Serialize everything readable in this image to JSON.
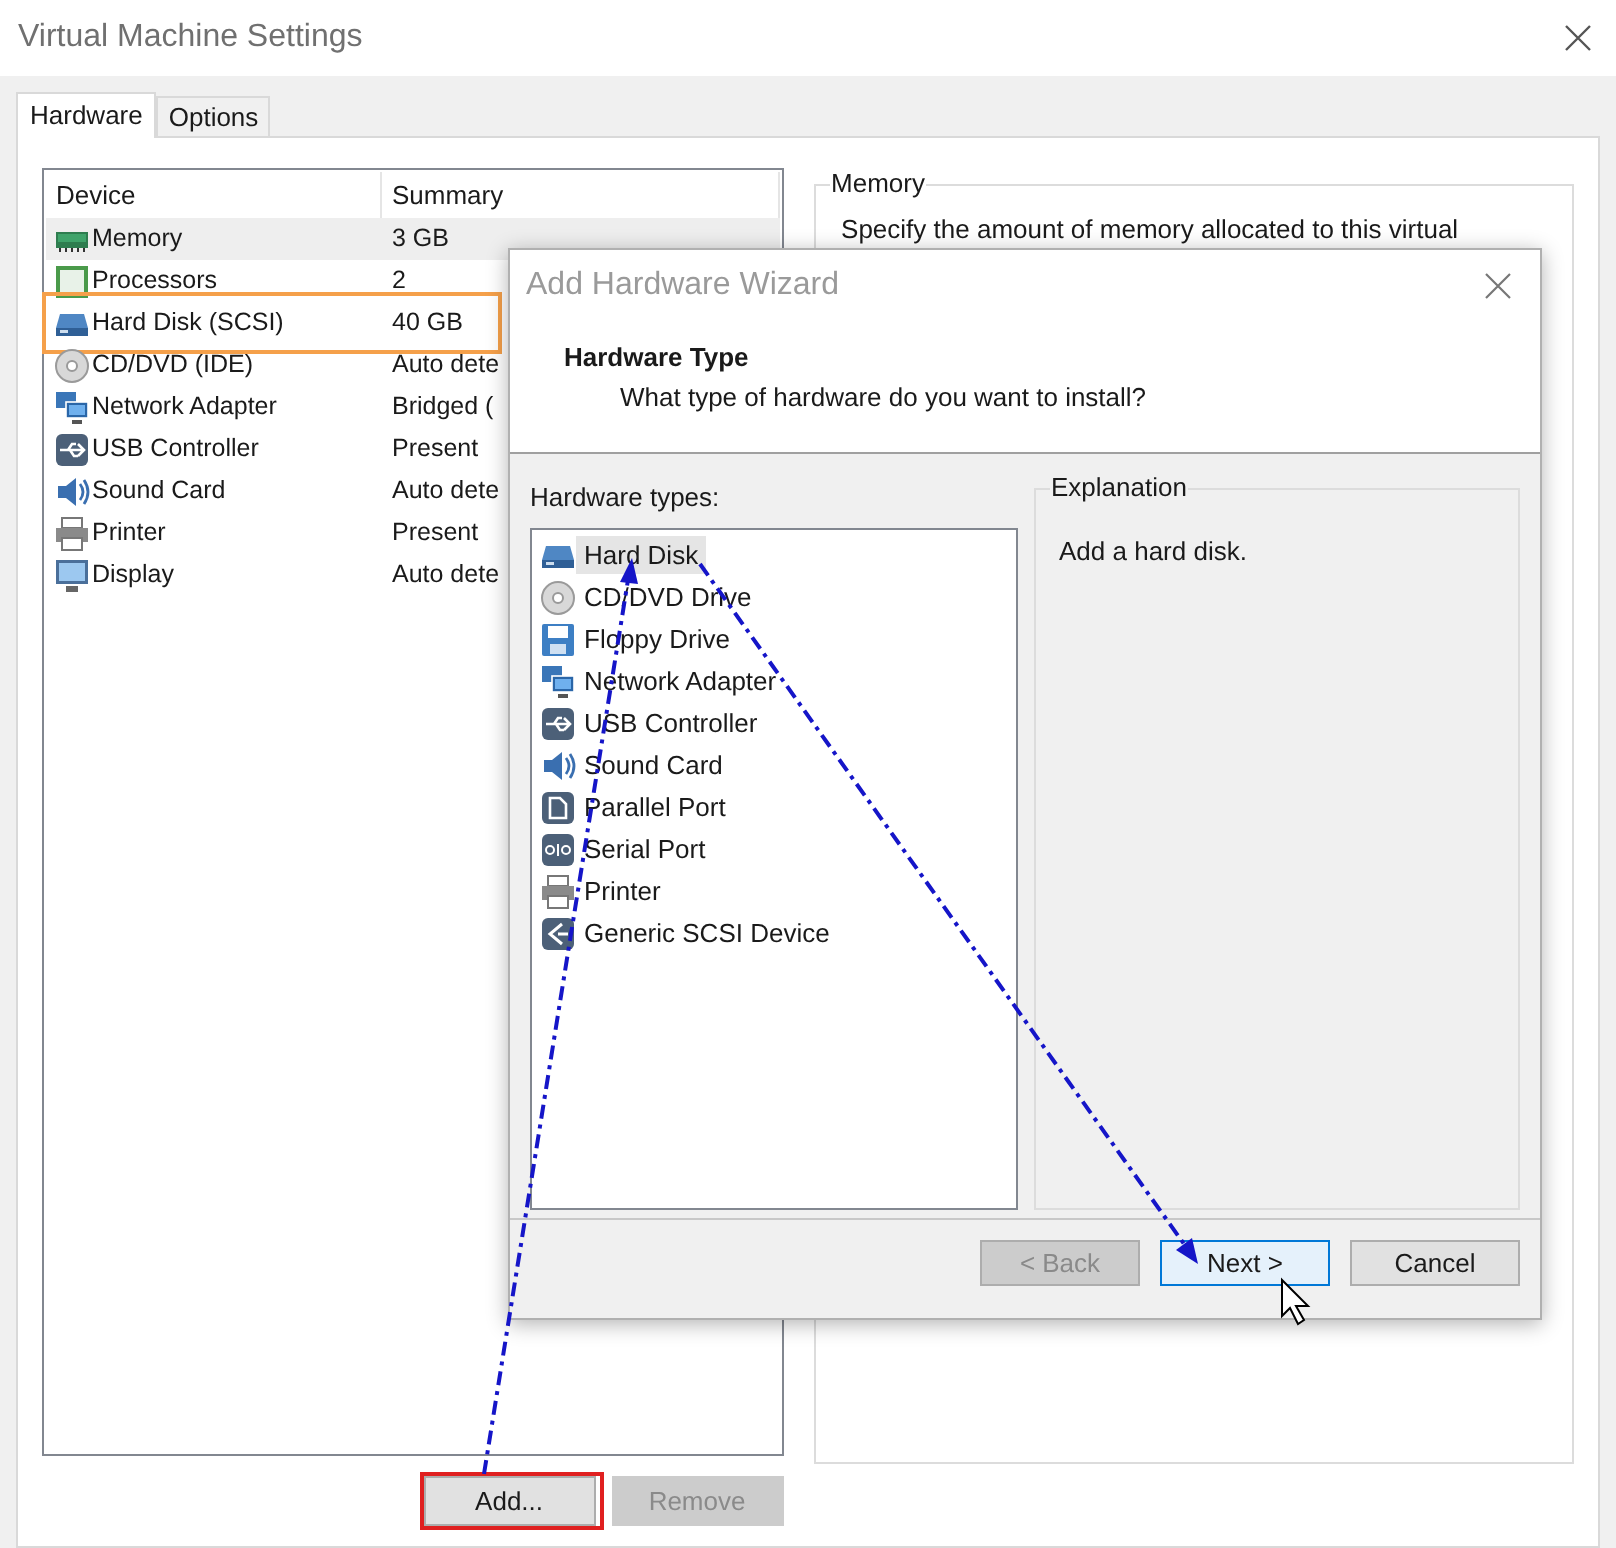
{
  "window": {
    "title": "Virtual Machine Settings"
  },
  "tabs": [
    {
      "label": "Hardware",
      "selected": true
    },
    {
      "label": "Options",
      "selected": false
    }
  ],
  "device_table": {
    "columns": [
      "Device",
      "Summary"
    ],
    "rows": [
      {
        "device": "Memory",
        "summary": "3 GB",
        "kind": "memory",
        "selected": true,
        "highlighted": false
      },
      {
        "device": "Processors",
        "summary": "2",
        "kind": "processor",
        "selected": false,
        "highlighted": false
      },
      {
        "device": "Hard Disk (SCSI)",
        "summary": "40 GB",
        "kind": "disk",
        "selected": false,
        "highlighted": true
      },
      {
        "device": "CD/DVD (IDE)",
        "summary": "Auto dete",
        "kind": "cd",
        "selected": false,
        "highlighted": false
      },
      {
        "device": "Network Adapter",
        "summary": "Bridged (",
        "kind": "network",
        "selected": false,
        "highlighted": false
      },
      {
        "device": "USB Controller",
        "summary": "Present",
        "kind": "usb",
        "selected": false,
        "highlighted": false
      },
      {
        "device": "Sound Card",
        "summary": "Auto dete",
        "kind": "sound",
        "selected": false,
        "highlighted": false
      },
      {
        "device": "Printer",
        "summary": "Present",
        "kind": "printer",
        "selected": false,
        "highlighted": false
      },
      {
        "device": "Display",
        "summary": "Auto dete",
        "kind": "display",
        "selected": false,
        "highlighted": false
      }
    ]
  },
  "table_buttons": [
    {
      "label": "Add...",
      "disabled": false,
      "highlighted": true
    },
    {
      "label": "Remove",
      "disabled": true,
      "highlighted": false
    }
  ],
  "memory_panel": {
    "title": "Memory",
    "description": "Specify the amount of memory allocated to this virtual"
  },
  "wizard": {
    "title": "Add Hardware Wizard",
    "heading": "Hardware Type",
    "subheading": "What type of hardware do you want to install?",
    "list_label": "Hardware types:",
    "hardware_types": [
      {
        "label": "Hard Disk",
        "kind": "disk",
        "selected": true
      },
      {
        "label": "CD/DVD Drive",
        "kind": "cd",
        "selected": false
      },
      {
        "label": "Floppy Drive",
        "kind": "floppy",
        "selected": false
      },
      {
        "label": "Network Adapter",
        "kind": "network",
        "selected": false
      },
      {
        "label": "USB Controller",
        "kind": "usb",
        "selected": false
      },
      {
        "label": "Sound Card",
        "kind": "sound",
        "selected": false
      },
      {
        "label": "Parallel Port",
        "kind": "parallel",
        "selected": false
      },
      {
        "label": "Serial Port",
        "kind": "serial",
        "selected": false
      },
      {
        "label": "Printer",
        "kind": "printer",
        "selected": false
      },
      {
        "label": "Generic SCSI Device",
        "kind": "scsi",
        "selected": false
      }
    ],
    "explanation": {
      "title": "Explanation",
      "text": "Add a hard disk."
    },
    "buttons": [
      {
        "label": "< Back",
        "disabled": true,
        "focused": false
      },
      {
        "label": "Next >",
        "disabled": false,
        "focused": true
      },
      {
        "label": "Cancel",
        "disabled": false,
        "focused": false
      }
    ]
  }
}
